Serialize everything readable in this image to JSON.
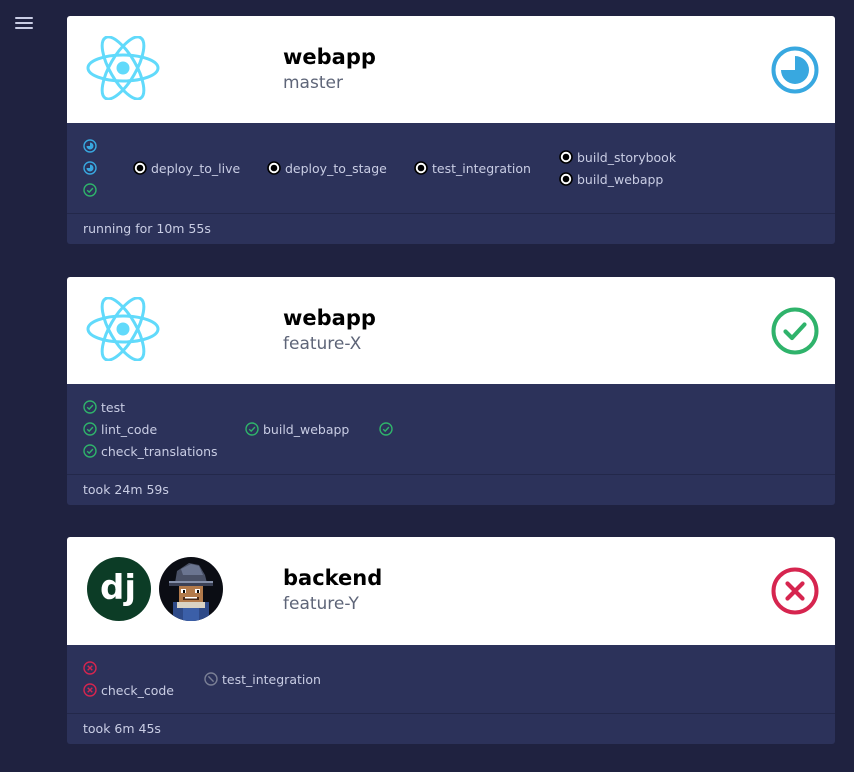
{
  "colors": {
    "background": "#1f2240",
    "card_body": "#2c325a",
    "running": "#38a8e0",
    "success": "#2fb36b",
    "failed": "#d6254f",
    "react": "#61dafb",
    "django": "#0c3c26"
  },
  "nav": {
    "menu_icon": "hamburger-icon"
  },
  "pipelines": [
    {
      "repo": "webapp",
      "branch": "master",
      "logos": [
        "react-logo"
      ],
      "status": "running",
      "stages": [
        {
          "jobs": [
            {
              "label": "",
              "status": "running"
            },
            {
              "label": "",
              "status": "running"
            },
            {
              "label": "",
              "status": "success"
            }
          ]
        },
        {
          "jobs": [
            {
              "label": "deploy_to_live",
              "status": "manual"
            }
          ]
        },
        {
          "jobs": [
            {
              "label": "deploy_to_stage",
              "status": "manual"
            }
          ]
        },
        {
          "jobs": [
            {
              "label": "test_integration",
              "status": "manual"
            }
          ]
        },
        {
          "jobs": [
            {
              "label": "build_storybook",
              "status": "manual"
            },
            {
              "label": "build_webapp",
              "status": "manual"
            }
          ]
        }
      ],
      "footer": "running for 10m 55s"
    },
    {
      "repo": "webapp",
      "branch": "feature-X",
      "logos": [
        "react-logo"
      ],
      "status": "success",
      "stages": [
        {
          "jobs": [
            {
              "label": "test",
              "status": "success"
            },
            {
              "label": "lint_code",
              "status": "success"
            },
            {
              "label": "check_translations",
              "status": "success"
            }
          ]
        },
        {
          "jobs": [
            {
              "label": "build_webapp",
              "status": "success"
            }
          ]
        },
        {
          "jobs": [
            {
              "label": "",
              "status": "success"
            }
          ]
        }
      ],
      "footer": "took 24m 59s"
    },
    {
      "repo": "backend",
      "branch": "feature-Y",
      "logos": [
        "django-logo",
        "wizard-avatar"
      ],
      "logo_text": "dj",
      "status": "failed",
      "stages": [
        {
          "jobs": [
            {
              "label": "",
              "status": "failed"
            },
            {
              "label": "check_code",
              "status": "failed"
            }
          ]
        },
        {
          "jobs": [
            {
              "label": "test_integration",
              "status": "skipped"
            }
          ]
        }
      ],
      "footer": "took 6m 45s"
    }
  ]
}
